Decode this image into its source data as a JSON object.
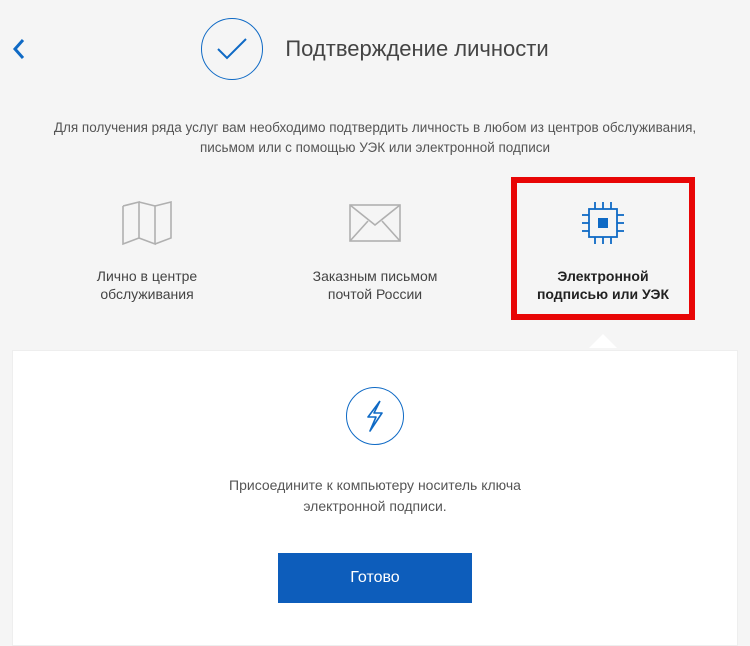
{
  "header": {
    "title": "Подтверждение личности"
  },
  "intro": {
    "line1": "Для получения ряда услуг вам необходимо подтвердить личность в любом из центров обслуживания,",
    "line2": "письмом или с помощью УЭК или электронной подписи"
  },
  "options": [
    {
      "label_line1": "Лично в центре",
      "label_line2": "обслуживания"
    },
    {
      "label_line1": "Заказным письмом",
      "label_line2": "почтой России"
    },
    {
      "label_line1": "Электронной",
      "label_line2": "подписью или УЭК"
    }
  ],
  "panel": {
    "text_line1": "Присоедините к компьютеру носитель ключа",
    "text_line2": "электронной подписи.",
    "button": "Готово"
  },
  "colors": {
    "accent": "#0f6ac5",
    "button": "#0d5dbb",
    "highlight": "#e80606"
  }
}
